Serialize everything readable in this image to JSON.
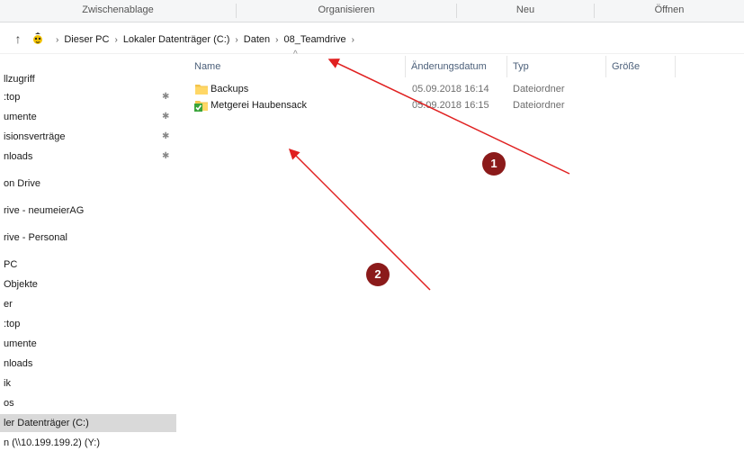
{
  "ribbon": {
    "groups": [
      "Zwischenablage",
      "Organisieren",
      "Neu",
      "Öffnen"
    ]
  },
  "address": {
    "crumbs": [
      "Dieser PC",
      "Lokaler Datenträger (C:)",
      "Daten",
      "08_Teamdrive"
    ]
  },
  "sidebar": {
    "items": [
      {
        "label": "llzugriff",
        "pinned": false
      },
      {
        "label": ":top",
        "pinned": true
      },
      {
        "label": "umente",
        "pinned": true
      },
      {
        "label": "isionsverträge",
        "pinned": true
      },
      {
        "label": "nloads",
        "pinned": true
      },
      {
        "label": "on Drive",
        "pinned": false
      },
      {
        "label": "rive - neumeierAG",
        "pinned": false
      },
      {
        "label": "rive - Personal",
        "pinned": false
      },
      {
        "label": "PC",
        "pinned": false
      },
      {
        "label": "Objekte",
        "pinned": false
      },
      {
        "label": "er",
        "pinned": false
      },
      {
        "label": ":top",
        "pinned": false
      },
      {
        "label": "umente",
        "pinned": false
      },
      {
        "label": "nloads",
        "pinned": false
      },
      {
        "label": "ik",
        "pinned": false
      },
      {
        "label": "os",
        "pinned": false
      },
      {
        "label": "ler Datenträger (C:)",
        "pinned": false,
        "selected": true
      },
      {
        "label": "n (\\\\10.199.199.2) (Y:)",
        "pinned": false
      }
    ],
    "pin_glyph": "✱"
  },
  "columns": {
    "name": "Name",
    "date": "Änderungsdatum",
    "type": "Typ",
    "size": "Größe"
  },
  "files": [
    {
      "name": "Backups",
      "date": "05.09.2018 16:14",
      "type": "Dateiordner",
      "icon": "folder-icon"
    },
    {
      "name": "Metgerei Haubensack",
      "date": "05.09.2018 16:15",
      "type": "Dateiordner",
      "icon": "synced-folder-icon"
    }
  ],
  "annotations": {
    "marker1": "1",
    "marker2": "2",
    "color": "#8b1a1a",
    "arrow_color": "#e02020"
  }
}
